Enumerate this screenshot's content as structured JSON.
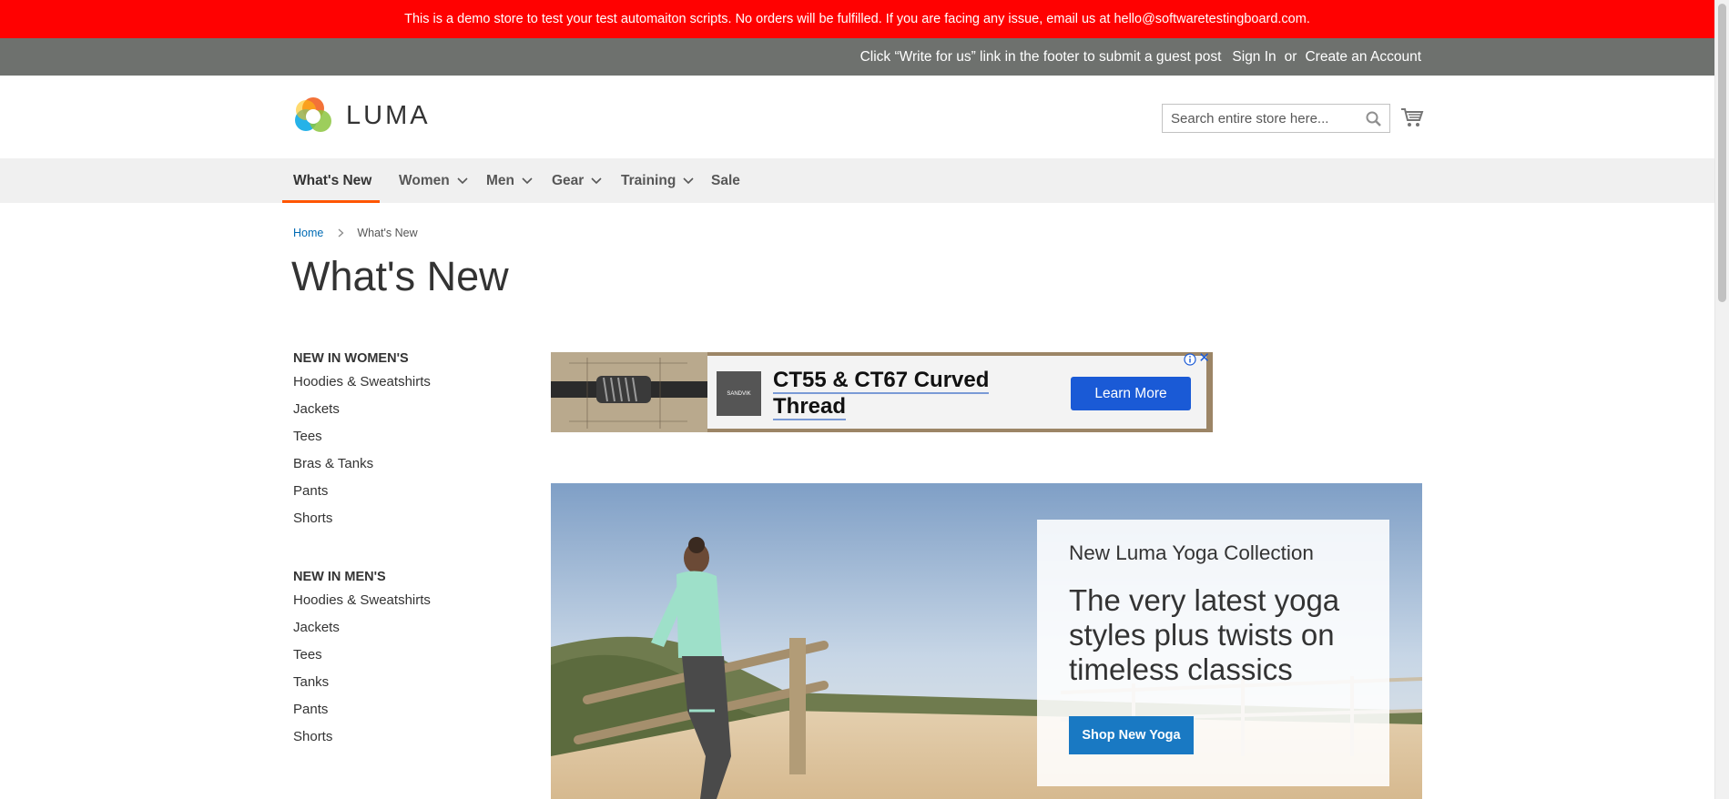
{
  "demo_notice": "This is a demo store to test your test automaiton scripts. No orders will be fulfilled. If you are facing any issue, email us at hello@softwaretestingboard.com.",
  "panel": {
    "promo": "Click “Write for us” link in the footer to submit a guest post",
    "sign_in": "Sign In",
    "or": "or",
    "create_account": "Create an Account"
  },
  "header": {
    "logo_text": "LUMA",
    "search_placeholder": "Search entire store here...",
    "search_icon": "search-icon",
    "cart_icon": "cart-icon"
  },
  "nav": {
    "items": [
      {
        "label": "What's New",
        "active": true,
        "has_dropdown": false
      },
      {
        "label": "Women",
        "active": false,
        "has_dropdown": true
      },
      {
        "label": "Men",
        "active": false,
        "has_dropdown": true
      },
      {
        "label": "Gear",
        "active": false,
        "has_dropdown": true
      },
      {
        "label": "Training",
        "active": false,
        "has_dropdown": true
      },
      {
        "label": "Sale",
        "active": false,
        "has_dropdown": false
      }
    ],
    "active_color": "#ff5501"
  },
  "breadcrumb": {
    "home": "Home",
    "current": "What's New"
  },
  "page_title": "What's New",
  "sidebar": {
    "women": {
      "heading": "NEW IN WOMEN'S",
      "items": [
        "Hoodies & Sweatshirts",
        "Jackets",
        "Tees",
        "Bras & Tanks",
        "Pants",
        "Shorts"
      ]
    },
    "men": {
      "heading": "NEW IN MEN'S",
      "items": [
        "Hoodies & Sweatshirts",
        "Jackets",
        "Tees",
        "Tanks",
        "Pants",
        "Shorts"
      ]
    }
  },
  "ad": {
    "brand": "SANDVIK",
    "headline": "CT55 & CT67 Curved Thread",
    "cta": "Learn More",
    "close": "✕"
  },
  "hero": {
    "subtitle": "New Luma Yoga Collection",
    "title": "The very latest yoga styles plus twists on timeless classics",
    "button": "Shop New Yoga"
  },
  "colors": {
    "demo_bar": "#ff0101",
    "panel_bar": "#6e716e",
    "link": "#006bb4",
    "primary_button": "#1979c3",
    "ad_button": "#1a5ad6"
  }
}
